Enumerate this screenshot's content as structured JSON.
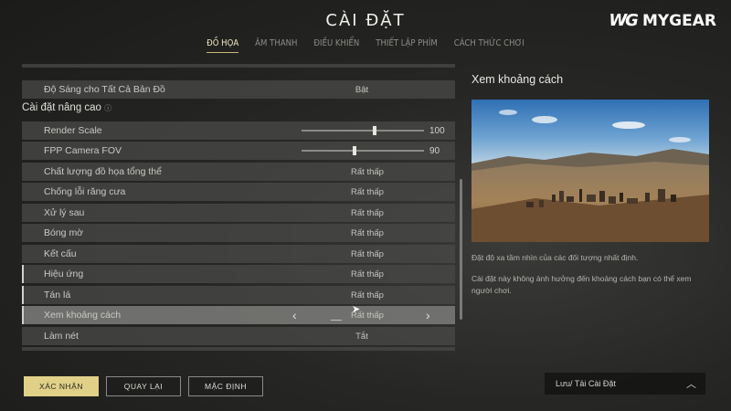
{
  "header": {
    "title": "CÀI ĐẶT",
    "brand": "MYGEAR",
    "brand_mark": "WG"
  },
  "tabs": [
    {
      "label": "ĐỒ HỌA",
      "active": true
    },
    {
      "label": "ÂM THANH",
      "active": false
    },
    {
      "label": "ĐIỀU KHIỂN",
      "active": false
    },
    {
      "label": "THIẾT LẬP PHÍM",
      "active": false
    },
    {
      "label": "CÁCH THỨC CHƠI",
      "active": false
    }
  ],
  "settings": {
    "brightness_all_maps": {
      "label": "Độ Sáng cho Tất Cả Bản Đồ",
      "value": "Bật"
    },
    "advanced_header": "Cài đặt nâng cao",
    "render_scale": {
      "label": "Render Scale",
      "value": "100",
      "fraction": 0.6
    },
    "fpp_fov": {
      "label": "FPP Camera FOV",
      "value": "90",
      "fraction": 0.43
    },
    "overall_quality": {
      "label": "Chất lượng đồ họa tổng thể",
      "value": "Rất thấp"
    },
    "anti_aliasing": {
      "label": "Chống lỗi răng cưa",
      "value": "Rất thấp"
    },
    "post_processing": {
      "label": "Xử lý sau",
      "value": "Rất thấp"
    },
    "shadows": {
      "label": "Bóng mờ",
      "value": "Rất thấp"
    },
    "textures": {
      "label": "Kết cấu",
      "value": "Rất thấp"
    },
    "effects": {
      "label": "Hiệu ứng",
      "value": "Rất thấp"
    },
    "foliage": {
      "label": "Tán lá",
      "value": "Rất thấp"
    },
    "view_distance": {
      "label": "Xem khoảng cách",
      "value": "Rất thấp"
    },
    "sharpen": {
      "label": "Làm nét",
      "value": "Tắt"
    }
  },
  "info": {
    "title": "Xem khoảng cách",
    "description": "Đặt độ xa tầm nhìn của các đối tượng nhất định.",
    "note": "Cài đặt này không ảnh hưởng đến khoảng cách bạn có thể xem người chơi."
  },
  "buttons": {
    "confirm": "XÁC NHẬN",
    "back": "QUAY LẠI",
    "default": "MẶC ĐỊNH",
    "save_load": "Lưu/ Tải Cài Đặt"
  },
  "colors": {
    "accent": "#e0d088",
    "row_bg": "#484846",
    "background": "#262624"
  }
}
